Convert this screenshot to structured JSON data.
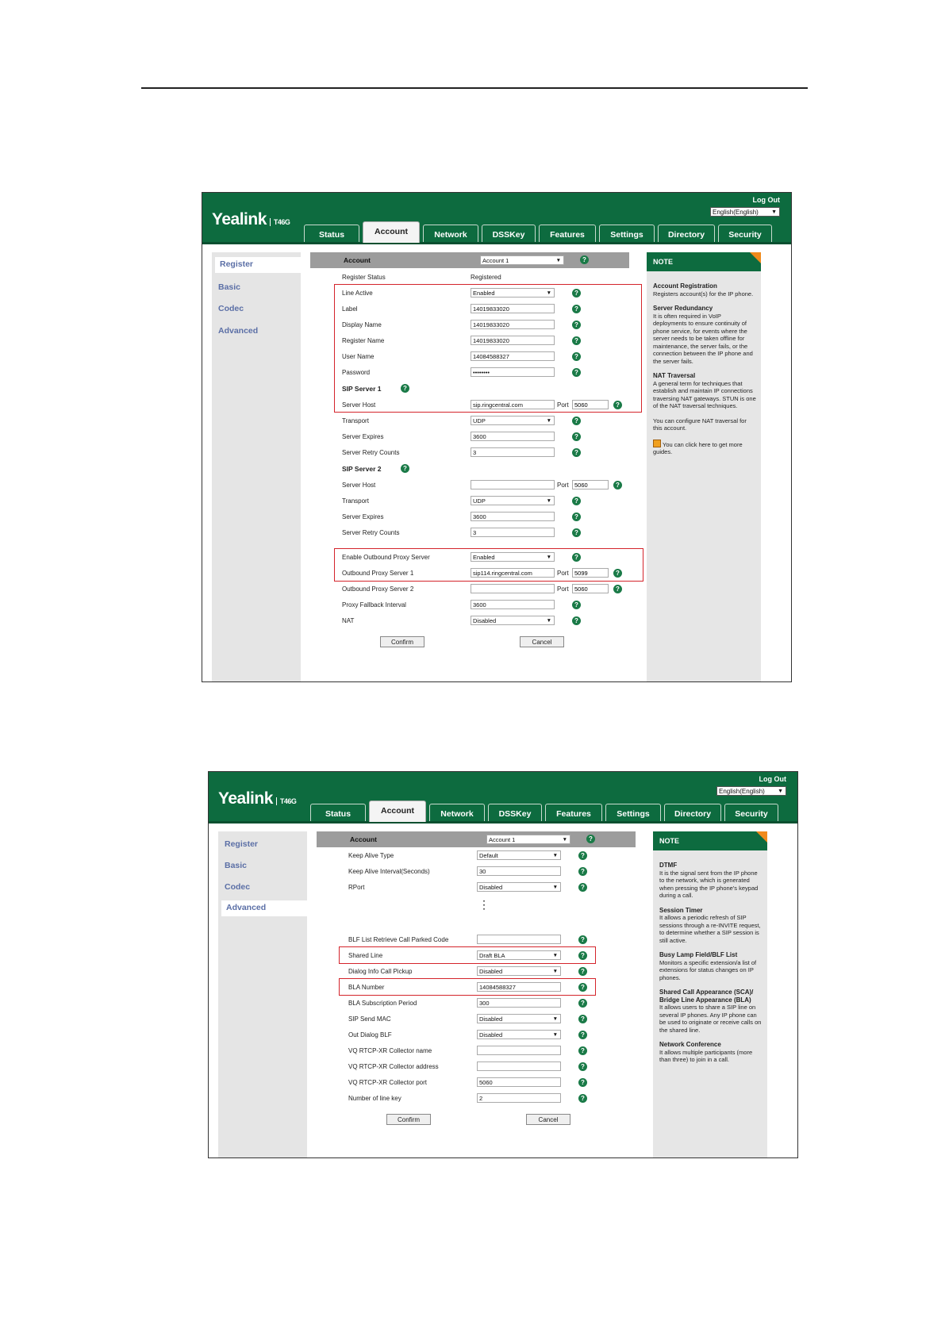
{
  "brand": {
    "name": "Yealink",
    "model": "T46G"
  },
  "header": {
    "logout": "Log Out",
    "language": "English(English)"
  },
  "tabs": [
    "Status",
    "Account",
    "Network",
    "DSSKey",
    "Features",
    "Settings",
    "Directory",
    "Security"
  ],
  "active_tab": "Account",
  "sidebar": [
    "Register",
    "Basic",
    "Codec",
    "Advanced"
  ],
  "help_glyph": "?",
  "arrow_glyph": "▼",
  "screen1": {
    "selected_sidebar": "Register",
    "account_label": "Account",
    "account_value": "Account 1",
    "register_status_label": "Register Status",
    "register_status_value": "Registered",
    "rows": {
      "line_active": {
        "label": "Line Active",
        "value": "Enabled"
      },
      "label": {
        "label": "Label",
        "value": "14019833020"
      },
      "display_name": {
        "label": "Display Name",
        "value": "14019833020"
      },
      "register_name": {
        "label": "Register Name",
        "value": "14019833020"
      },
      "user_name": {
        "label": "User Name",
        "value": "14084588327"
      },
      "password": {
        "label": "Password",
        "value": "••••••••"
      },
      "sip_server_1": {
        "label": "SIP Server 1"
      },
      "s1_server_host": {
        "label": "Server Host",
        "value": "sip.ringcentral.com",
        "port_label": "Port",
        "port": "5060"
      },
      "s1_transport": {
        "label": "Transport",
        "value": "UDP"
      },
      "s1_server_expires": {
        "label": "Server Expires",
        "value": "3600"
      },
      "s1_retry": {
        "label": "Server Retry Counts",
        "value": "3"
      },
      "sip_server_2": {
        "label": "SIP Server 2"
      },
      "s2_server_host": {
        "label": "Server Host",
        "value": "",
        "port_label": "Port",
        "port": "5060"
      },
      "s2_transport": {
        "label": "Transport",
        "value": "UDP"
      },
      "s2_server_expires": {
        "label": "Server Expires",
        "value": "3600"
      },
      "s2_retry": {
        "label": "Server Retry Counts",
        "value": "3"
      },
      "outbound_enable": {
        "label": "Enable Outbound Proxy Server",
        "value": "Enabled"
      },
      "outbound_1": {
        "label": "Outbound Proxy Server 1",
        "value": "sip114.ringcentral.com",
        "port_label": "Port",
        "port": "5099"
      },
      "outbound_2": {
        "label": "Outbound Proxy Server 2",
        "value": "",
        "port_label": "Port",
        "port": "5060"
      },
      "proxy_fallback": {
        "label": "Proxy Fallback Interval",
        "value": "3600"
      },
      "nat": {
        "label": "NAT",
        "value": "Disabled"
      }
    },
    "buttons": {
      "confirm": "Confirm",
      "cancel": "Cancel"
    },
    "note": {
      "title": "NOTE",
      "sections": [
        {
          "title": "Account Registration",
          "text": "Registers account(s) for the IP phone."
        },
        {
          "title": "Server Redundancy",
          "text": "It is often required in VoIP deployments to ensure continuity of phone service, for events where the server needs to be taken offline for maintenance, the server fails, or the connection between the IP phone and the server fails."
        },
        {
          "title": "NAT Traversal",
          "text": "A general term for techniques that establish and maintain IP connections traversing NAT gateways. STUN is one of the NAT traversal techniques."
        }
      ],
      "extra": "You can configure NAT traversal for this account.",
      "guide": "You can click here to get more guides."
    }
  },
  "screen2": {
    "selected_sidebar": "Advanced",
    "account_label": "Account",
    "account_value": "Account 1",
    "rows": {
      "keep_alive_type": {
        "label": "Keep Alive Type",
        "value": "Default"
      },
      "keep_alive_interval": {
        "label": "Keep Alive Interval(Seconds)",
        "value": "30"
      },
      "rport": {
        "label": "RPort",
        "value": "Disabled"
      },
      "blf_retrieve": {
        "label": "BLF List Retrieve Call Parked Code",
        "value": ""
      },
      "shared_line": {
        "label": "Shared Line",
        "value": "Draft BLA"
      },
      "dialog_info": {
        "label": "Dialog Info Call Pickup",
        "value": "Disabled"
      },
      "bla_number": {
        "label": "BLA Number",
        "value": "14084588327"
      },
      "bla_sub": {
        "label": "BLA Subscription Period",
        "value": "300"
      },
      "sip_send_mac": {
        "label": "SIP Send MAC",
        "value": "Disabled"
      },
      "out_dialog_blf": {
        "label": "Out Dialog BLF",
        "value": "Disabled"
      },
      "vq_name": {
        "label": "VQ RTCP-XR Collector name",
        "value": ""
      },
      "vq_address": {
        "label": "VQ RTCP-XR Collector address",
        "value": ""
      },
      "vq_port": {
        "label": "VQ RTCP-XR Collector port",
        "value": "5060"
      },
      "line_keys": {
        "label": "Number of line key",
        "value": "2"
      }
    },
    "ellipsis": "⋮",
    "buttons": {
      "confirm": "Confirm",
      "cancel": "Cancel"
    },
    "note": {
      "title": "NOTE",
      "sections": [
        {
          "title": "DTMF",
          "text": "It is the signal sent from the IP phone to the network, which is generated when pressing the IP phone's keypad during a call."
        },
        {
          "title": "Session Timer",
          "text": "It allows a periodic refresh of SIP sessions through a re-INVITE request, to determine whether a SIP session is still active."
        },
        {
          "title": "Busy Lamp Field/BLF List",
          "text": "Monitors a specific extension/a list of extensions for status changes on IP phones."
        },
        {
          "title": "Shared Call Appearance (SCA)/ Bridge Line Appearance (BLA)",
          "text": "It allows users to share a SIP line on several IP phones. Any IP phone can be used to originate or receive calls on the shared line."
        },
        {
          "title": "Network Conference",
          "text": "It allows multiple participants (more than three) to join in a call."
        }
      ]
    }
  }
}
